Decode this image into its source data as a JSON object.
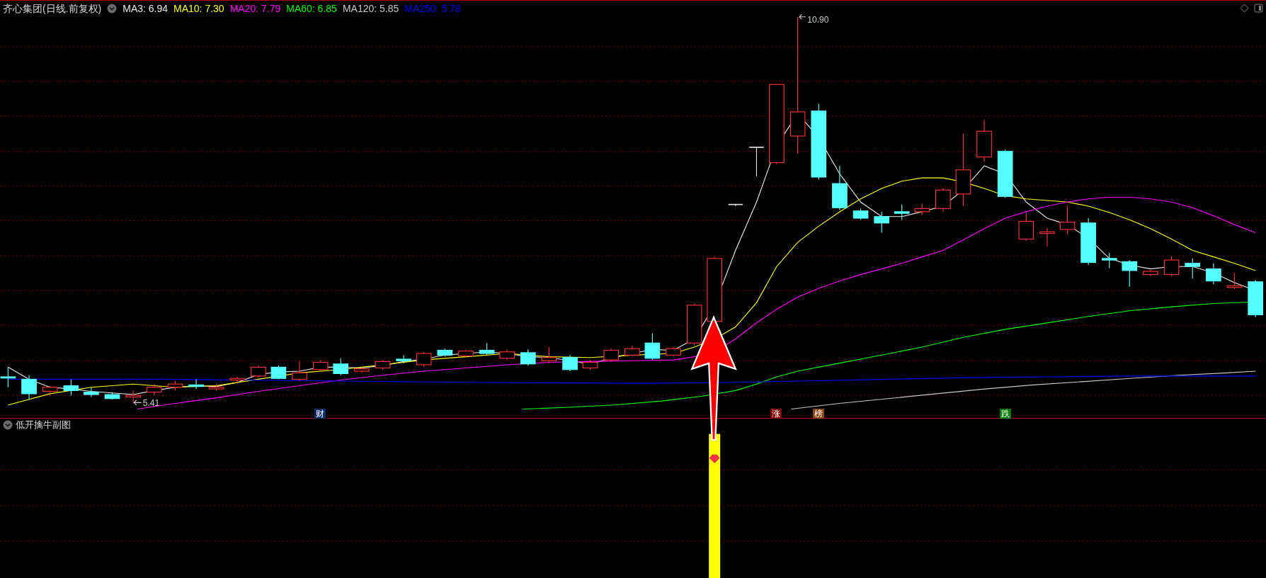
{
  "chart": {
    "title": "齐心集团(日线.前复权)",
    "moving_averages": [
      {
        "label": "MA3: 6.94",
        "color": "#e8e8e8"
      },
      {
        "label": "MA10: 7.30",
        "color": "#ffff00"
      },
      {
        "label": "MA20: 7.79",
        "color": "#ff00ff"
      },
      {
        "label": "MA60: 6.85",
        "color": "#00ff00"
      },
      {
        "label": "MA120: 5.85",
        "color": "#c8c8c8"
      },
      {
        "label": "MA250: 5.78",
        "color": "#0000ff"
      }
    ],
    "price_labels": [
      {
        "kind": "high",
        "text": "10.90"
      },
      {
        "kind": "low",
        "text": "5.41"
      }
    ],
    "signals": [
      {
        "text": "财",
        "color": "#0a2a6e"
      },
      {
        "text": "涨",
        "color": "#800000"
      },
      {
        "text": "榜",
        "color": "#8b4513"
      },
      {
        "text": "跌",
        "color": "#0a7a0a"
      }
    ]
  },
  "subchart": {
    "title": "低开擒牛副图"
  }
}
